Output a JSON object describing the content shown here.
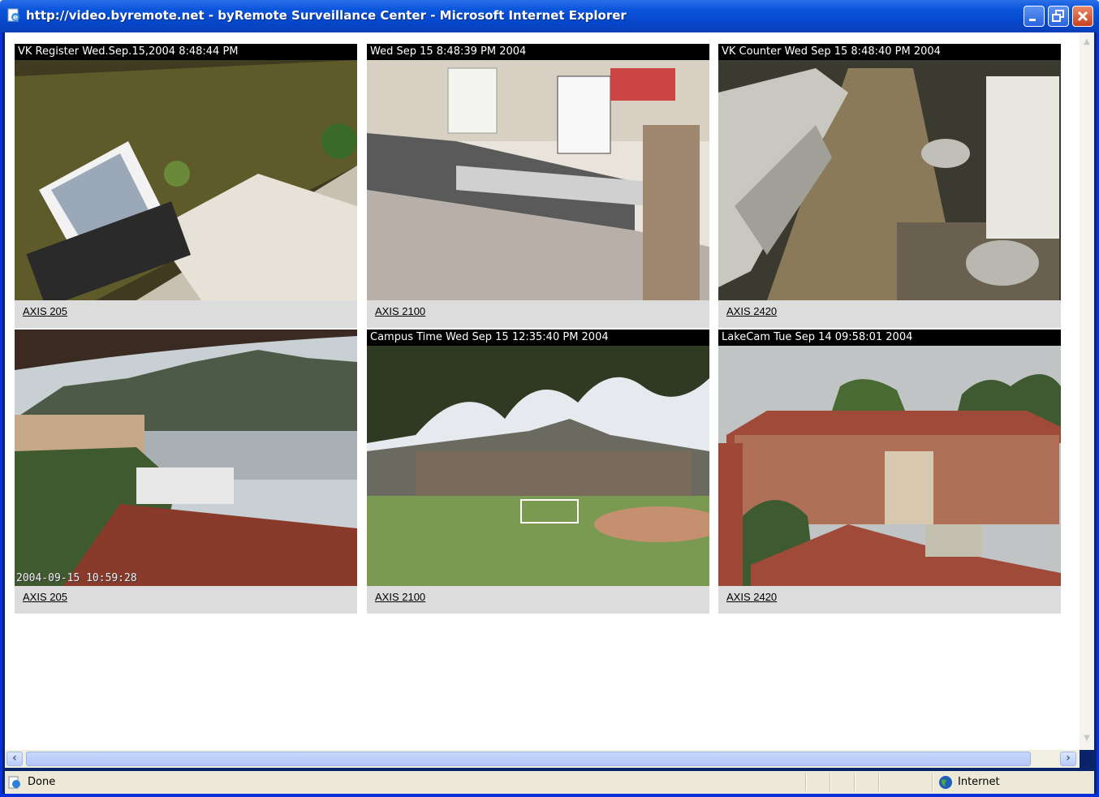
{
  "window": {
    "title": "http://video.byremote.net - byRemote Surveillance Center - Microsoft Internet Explorer"
  },
  "cameras": [
    {
      "overlay": "VK Register  Wed.Sep.15,2004  8:48:44 PM",
      "link": "AXIS 205",
      "scene": "register"
    },
    {
      "overlay": " Wed Sep 15   8:48:39 PM  2004",
      "link": "AXIS 2100",
      "scene": "restaurant"
    },
    {
      "overlay": "VK Counter  Wed Sep 15   8:48:40 PM  2004",
      "link": "AXIS 2420",
      "scene": "kitchen"
    },
    {
      "overlay": "",
      "stamp": "2004-09-15 10:59:28",
      "link": "AXIS 205",
      "scene": "lake"
    },
    {
      "overlay": "Campus Time  Wed Sep 15  12:35:40 PM  2004",
      "link": "AXIS 2100",
      "scene": "campus"
    },
    {
      "overlay": "LakeCam  Tue Sep 14  09:58:01  2004",
      "link": "AXIS 2420",
      "scene": "building"
    }
  ],
  "status": {
    "text": "Done",
    "zone": "Internet",
    "icons": {
      "page": "ie-page-icon",
      "zone": "globe-icon"
    }
  }
}
